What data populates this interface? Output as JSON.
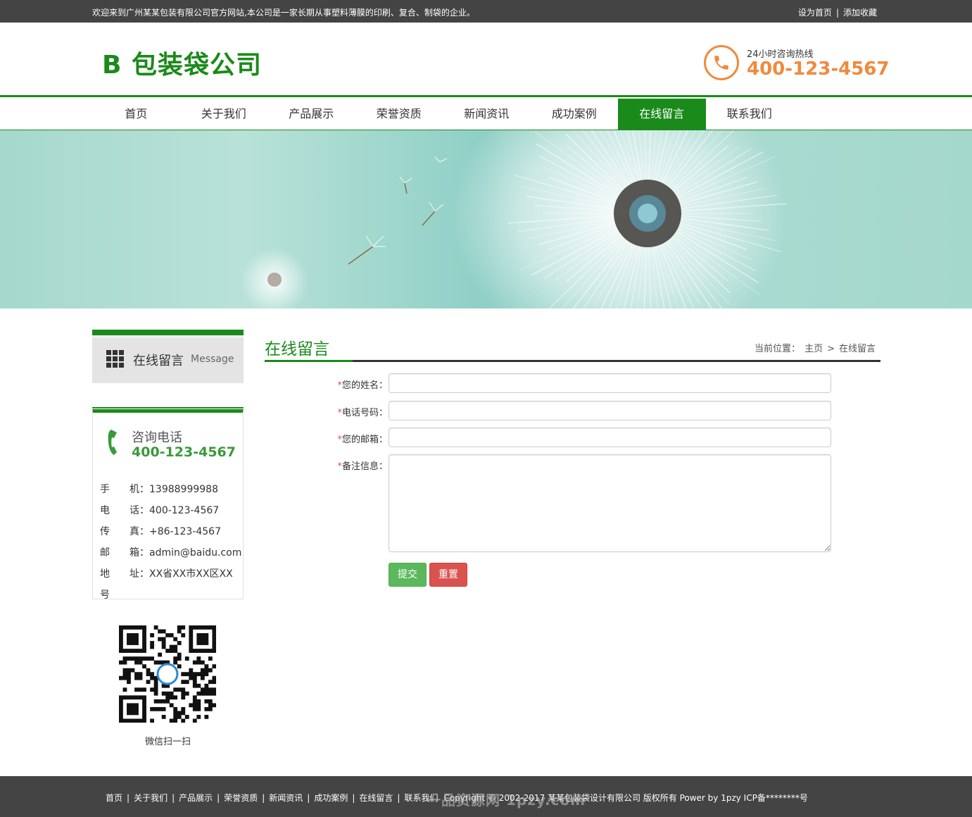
{
  "topbar": {
    "welcome": "欢迎来到广州某某包装有限公司官方网站,本公司是一家长期从事塑料薄膜的印刷、复合、制袋的企业。",
    "set_home": "设为首页",
    "separator": "|",
    "add_favorite": "添加收藏"
  },
  "header": {
    "logo_text": "B 包装袋公司",
    "hotline_label": "24小时咨询热线",
    "hotline_number": "400-123-4567",
    "hotline_icon": "phone-icon",
    "accent_color": "#f08a3e",
    "brand_color": "#1a8a1a"
  },
  "nav": {
    "items": [
      {
        "label": "首页"
      },
      {
        "label": "关于我们"
      },
      {
        "label": "产品展示"
      },
      {
        "label": "荣誉资质"
      },
      {
        "label": "新闻资讯"
      },
      {
        "label": "成功案例"
      },
      {
        "label": "在线留言"
      },
      {
        "label": "联系我们"
      }
    ],
    "active": "在线留言"
  },
  "sidebar": {
    "title": "在线留言",
    "subtitle": "Message",
    "contact": {
      "title": "咨询电话",
      "number": "400-123-4567",
      "rows": [
        "手　　机：13988999988",
        "电　　话：400-123-4567",
        "传　　真：+86-123-4567",
        "邮　　箱：admin@baidu.com",
        "地　　址：XX省XX市XX区XX",
        "号"
      ]
    },
    "qr_caption": "微信扫一扫"
  },
  "main": {
    "title": "在线留言",
    "breadcrumb": {
      "label": "当前位置：",
      "home": "主页",
      "sep": ">",
      "current": "在线留言"
    },
    "form": {
      "required_mark": "*",
      "name_label": "您的姓名：",
      "phone_label": "电话号码：",
      "email_label": "您的邮箱：",
      "remark_label": "备注信息：",
      "name_value": "",
      "phone_value": "",
      "email_value": "",
      "remark_value": "",
      "submit_label": "提交",
      "reset_label": "重置"
    }
  },
  "footer": {
    "links": [
      "首页",
      "关于我们",
      "产品展示",
      "荣誉资质",
      "新闻资讯",
      "成功案例",
      "在线留言",
      "联系我们"
    ],
    "separator": "|",
    "copyright": "Copyright © 2002-2017 某某包装袋设计有限公司 版权所有 Power by 1pzy ICP备********号",
    "watermark": "一品资源网 1pzy.com"
  }
}
